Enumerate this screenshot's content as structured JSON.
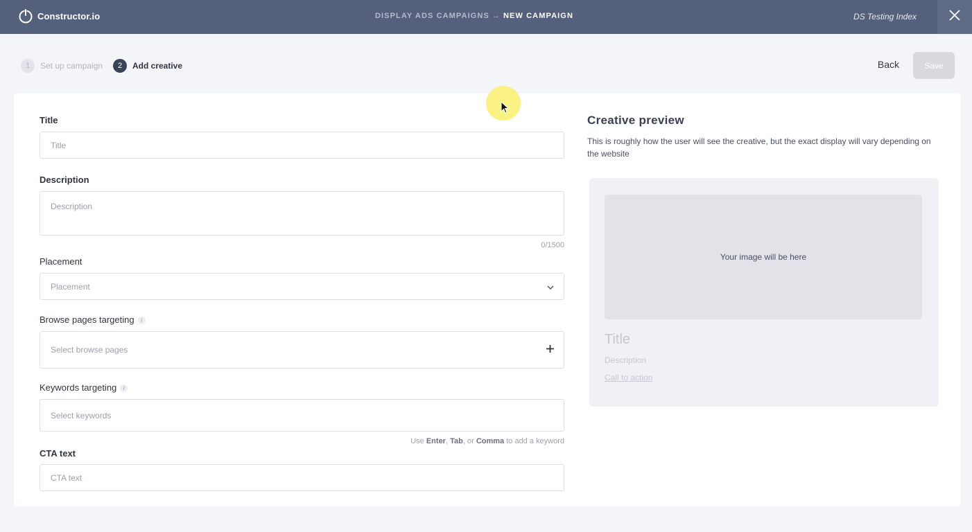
{
  "app": {
    "logo_text": "Constructor.io",
    "breadcrumb_parent": "DISPLAY ADS CAMPAIGNS",
    "breadcrumb_arrow": "→",
    "breadcrumb_current": "NEW CAMPAIGN",
    "index_name": "DS Testing Index",
    "header_color": "#55607d"
  },
  "steps": [
    {
      "number": "1",
      "label": "Set up campaign",
      "state": "done"
    },
    {
      "number": "2",
      "label": "Add creative",
      "state": "active"
    }
  ],
  "actions": {
    "back_label": "Back",
    "save_label": "Save"
  },
  "form": {
    "title": {
      "label": "Title",
      "placeholder": "Title"
    },
    "description": {
      "label": "Description",
      "placeholder": "Description",
      "counter": "0/1500"
    },
    "placement": {
      "label": "Placement",
      "placeholder": "Placement"
    },
    "browse_pages": {
      "label": "Browse pages targeting",
      "placeholder": "Select browse pages",
      "info": "i"
    },
    "keywords": {
      "label": "Keywords targeting",
      "placeholder": "Select keywords",
      "info": "i",
      "hint_prefix": "Use",
      "hint_k1": "Enter",
      "hint_sep1": ",",
      "hint_k2": "Tab",
      "hint_sep2": ", or",
      "hint_k3": "Comma",
      "hint_suffix": "to add a keyword"
    },
    "cta": {
      "label": "CTA text",
      "placeholder": "CTA text"
    }
  },
  "preview": {
    "heading": "Creative preview",
    "subtitle": "This is roughly how the user will see the creative, but the exact display will vary depending on the website",
    "image_placeholder": "Your image will be here",
    "title": "Title",
    "description": "Description",
    "cta": "Call to action"
  }
}
